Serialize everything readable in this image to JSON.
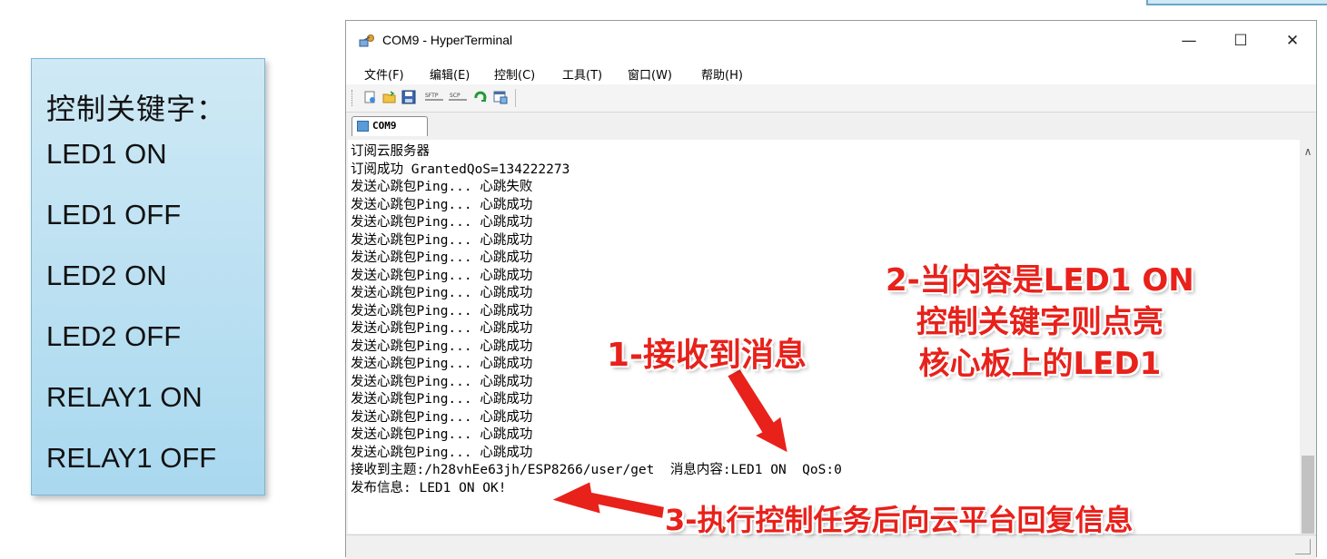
{
  "keyword_panel": {
    "title": "控制关键字：",
    "items": [
      "LED1 ON",
      "LED1 OFF",
      "LED2 ON",
      "LED2 OFF",
      "RELAY1 ON",
      "RELAY1 OFF"
    ]
  },
  "window": {
    "title": "COM9 - HyperTerminal",
    "controls": {
      "minimize": "—",
      "maximize": "☐",
      "close": "✕"
    },
    "menu": [
      "文件(F)",
      "编辑(E)",
      "控制(C)",
      "工具(T)",
      "窗口(W)",
      "帮助(H)"
    ],
    "toolbar_icons": [
      "new-icon",
      "open-folder-icon",
      "save-icon",
      "sftp-icon",
      "scp-icon",
      "reconnect-icon",
      "properties-icon"
    ],
    "toolbar_labels": {
      "sftp": "SFTP",
      "scp": "SCP"
    },
    "tab_label": "COM9",
    "terminal_lines": [
      "订阅云服务器",
      "订阅成功 GrantedQoS=134222273",
      "发送心跳包Ping... 心跳失败",
      "发送心跳包Ping... 心跳成功",
      "发送心跳包Ping... 心跳成功",
      "发送心跳包Ping... 心跳成功",
      "发送心跳包Ping... 心跳成功",
      "发送心跳包Ping... 心跳成功",
      "发送心跳包Ping... 心跳成功",
      "发送心跳包Ping... 心跳成功",
      "发送心跳包Ping... 心跳成功",
      "发送心跳包Ping... 心跳成功",
      "发送心跳包Ping... 心跳成功",
      "发送心跳包Ping... 心跳成功",
      "发送心跳包Ping... 心跳成功",
      "发送心跳包Ping... 心跳成功",
      "发送心跳包Ping... 心跳成功",
      "发送心跳包Ping... 心跳成功",
      "接收到主题:/h28vhEe63jh/ESP8266/user/get  消息内容:LED1 ON  QoS:0",
      "发布信息: LED1 ON OK!"
    ]
  },
  "annotations": {
    "a1": "1-接收到消息",
    "a2_lines": [
      "2-当内容是LED1 ON",
      "控制关键字则点亮",
      "核心板上的LED1"
    ],
    "a3": "3-执行控制任务后向云平台回复信息"
  },
  "colors": {
    "annotation": "#e8211b",
    "panel_bg": "#bfe2f2"
  }
}
